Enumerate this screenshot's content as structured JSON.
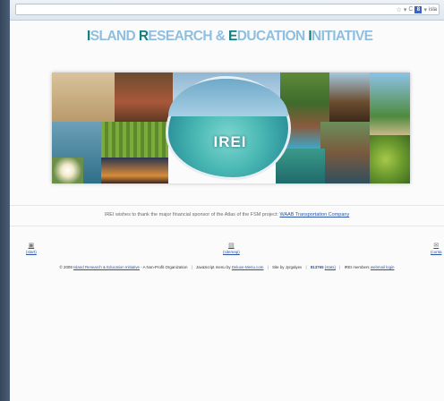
{
  "browser": {
    "search_engine_label": "8",
    "search_text": "isla",
    "star_icon": "star-icon",
    "reload_icon": "reload-icon"
  },
  "site": {
    "title_words": [
      {
        "cap": "I",
        "rest": "SLAND "
      },
      {
        "cap": "R",
        "rest": "ESEARCH & "
      },
      {
        "cap": "E",
        "rest": "DUCATION "
      },
      {
        "cap": "I",
        "rest": "NITIATIVE"
      }
    ],
    "logo_text": "IREI"
  },
  "sponsor": {
    "text": "IREI wishes to thank the major financial sponsor of the Atlas of the FSM project:",
    "link": "WAAB Transportation Company"
  },
  "nav": {
    "left_label": "(start)",
    "middle_label": "(sitemap)",
    "right_label": "(conta"
  },
  "footer": {
    "copyright": "© 2009",
    "org_link": "Island Research & Education Initiative",
    "org_suffix": " - A Non-Profit Organization",
    "menu_prefix": "JavaScript menu by ",
    "menu_link": "Deluxe-Menu.com",
    "site_by": "Site by Jyrgalyev",
    "counter": "813765",
    "counter_label": "(stats)",
    "members_prefix": "IREI members ",
    "members_link": "webmail login"
  },
  "colors": {
    "title_light": "#8fbfe0",
    "title_cap": "#127f80",
    "link": "#2b53a8"
  }
}
